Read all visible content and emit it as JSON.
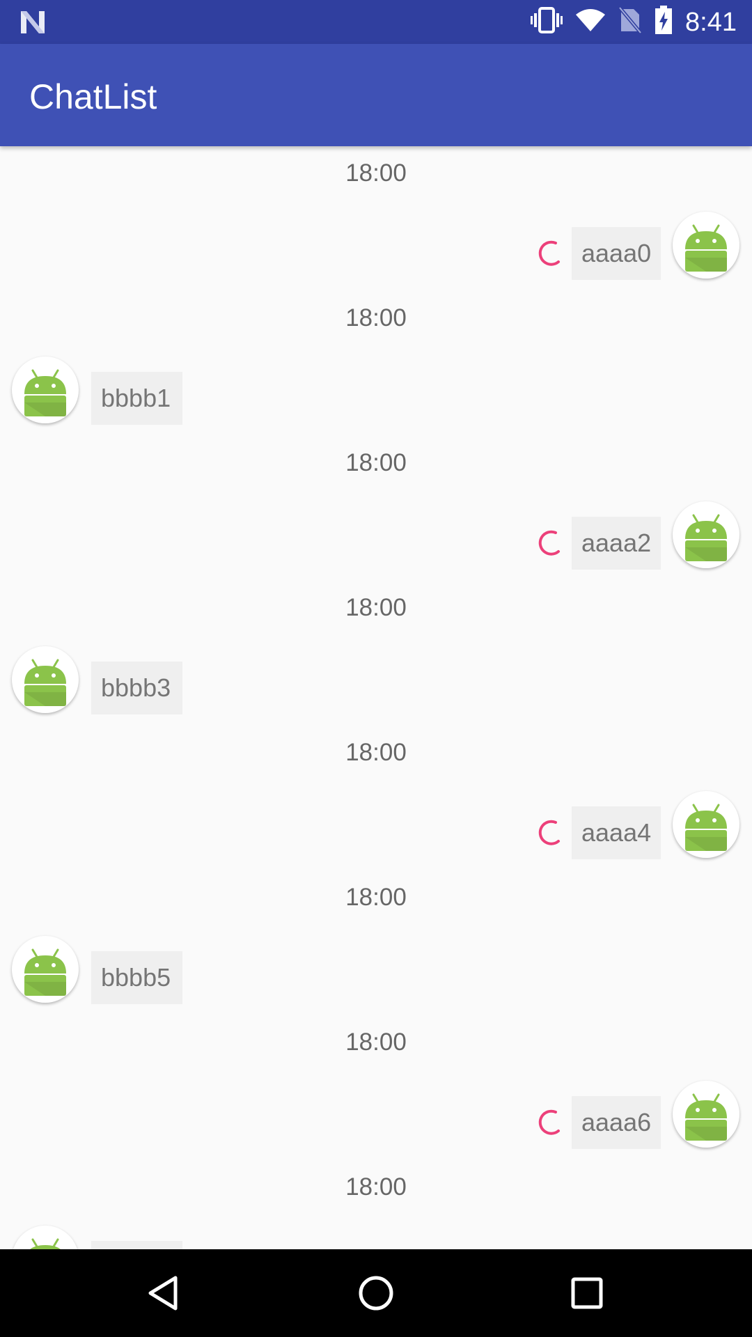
{
  "status_bar": {
    "time": "8:41",
    "icons": [
      "notification-n-icon",
      "vibrate-icon",
      "wifi-icon",
      "no-sim-icon",
      "battery-charging-icon"
    ]
  },
  "app_bar": {
    "title": "ChatList"
  },
  "colors": {
    "status_bar": "#303f9f",
    "app_bar": "#3f51b5",
    "spinner": "#ec407a",
    "bubble": "#efefef",
    "android_green": "#8bc34a"
  },
  "messages": [
    {
      "time": "18:00",
      "side": "right",
      "text": "aaaa0",
      "sending": true
    },
    {
      "time": "18:00",
      "side": "left",
      "text": "bbbb1",
      "sending": false
    },
    {
      "time": "18:00",
      "side": "right",
      "text": "aaaa2",
      "sending": true
    },
    {
      "time": "18:00",
      "side": "left",
      "text": "bbbb3",
      "sending": false
    },
    {
      "time": "18:00",
      "side": "right",
      "text": "aaaa4",
      "sending": true
    },
    {
      "time": "18:00",
      "side": "left",
      "text": "bbbb5",
      "sending": false
    },
    {
      "time": "18:00",
      "side": "right",
      "text": "aaaa6",
      "sending": true
    },
    {
      "time": "18:00",
      "side": "left",
      "text": "",
      "sending": false
    }
  ],
  "nav_bar": {
    "buttons": [
      "back-icon",
      "home-icon",
      "recents-icon"
    ]
  }
}
